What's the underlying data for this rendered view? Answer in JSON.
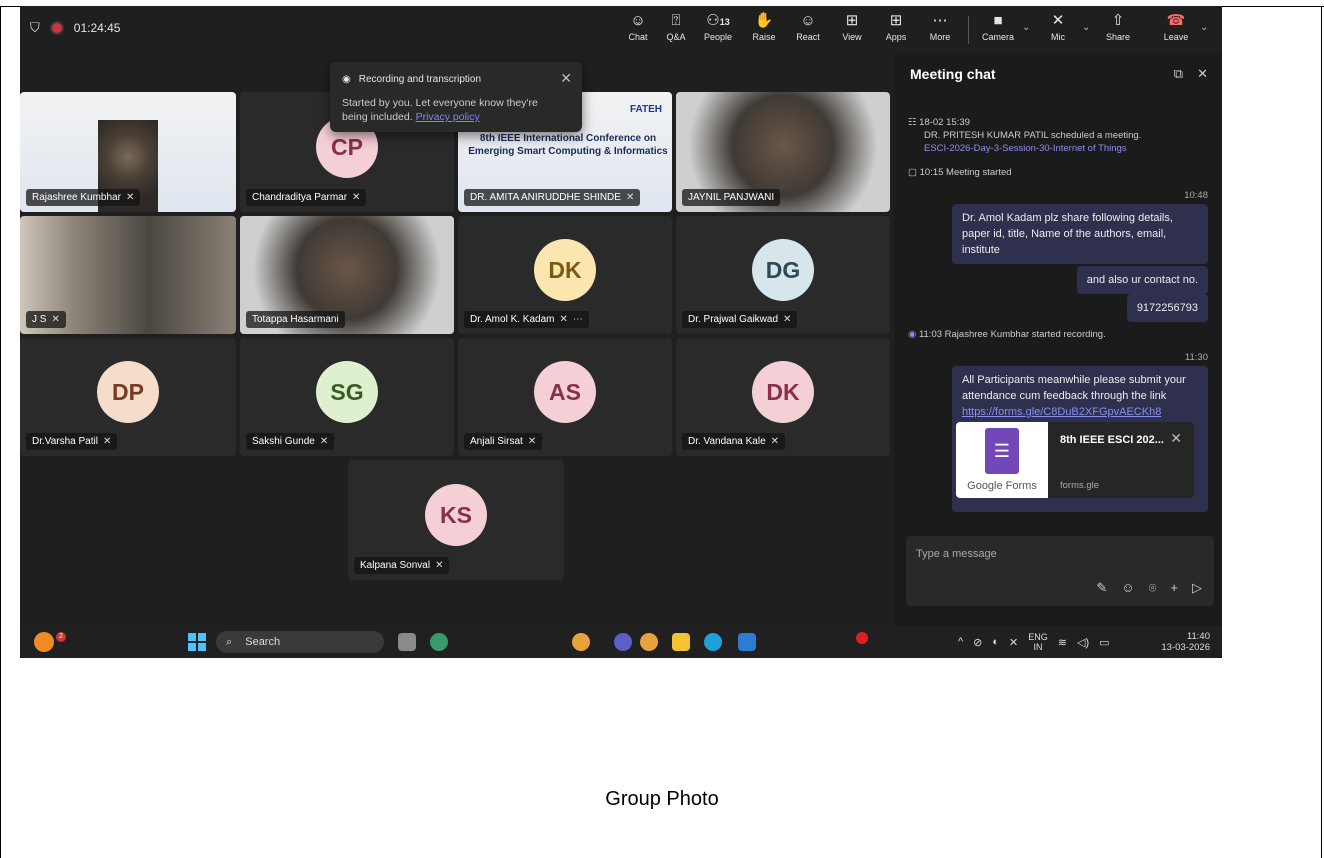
{
  "topbar": {
    "timer": "01:24:45",
    "buttons": [
      {
        "label": "Chat",
        "icon": "chat-icon"
      },
      {
        "label": "Q&A",
        "icon": "qa-icon"
      },
      {
        "label": "People",
        "icon": "people-icon",
        "count": "13"
      },
      {
        "label": "Raise",
        "icon": "raise-hand-icon"
      },
      {
        "label": "React",
        "icon": "react-icon"
      },
      {
        "label": "View",
        "icon": "view-icon"
      },
      {
        "label": "Apps",
        "icon": "apps-icon"
      },
      {
        "label": "More",
        "icon": "more-icon"
      },
      {
        "label": "Camera",
        "icon": "camera-icon"
      },
      {
        "label": "Mic",
        "icon": "mic-muted-icon"
      },
      {
        "label": "Share",
        "icon": "share-icon"
      },
      {
        "label": "Leave",
        "icon": "leave-icon"
      }
    ],
    "people_count": "13"
  },
  "popup": {
    "title": "Recording and transcription",
    "body": "Started by you. Let everyone know they're being included.",
    "link": "Privacy policy"
  },
  "tiles": [
    {
      "name": "Rajashree Kumbhar",
      "kind": "video"
    },
    {
      "name": "Chandraditya Parmar",
      "initials": "CP",
      "color": "#f4cfd6",
      "text": "#8a2f4a"
    },
    {
      "name": "DR. AMITA ANIRUDDHE SHINDE",
      "kind": "video"
    },
    {
      "name": "JAYNIL PANJWANI",
      "kind": "video"
    },
    {
      "name": "J S",
      "kind": "video"
    },
    {
      "name": "Totappa Hasarmani",
      "kind": "video"
    },
    {
      "name": "Dr. Amol K. Kadam",
      "initials": "DK",
      "color": "#fbe6b0",
      "text": "#7a5a10"
    },
    {
      "name": "Dr. Prajwal Gaikwad",
      "initials": "DG",
      "color": "#d7e6ec",
      "text": "#2d4a56"
    },
    {
      "name": "Dr.Varsha Patil",
      "initials": "DP",
      "color": "#f6dccb",
      "text": "#7a3a22"
    },
    {
      "name": "Sakshi Gunde",
      "initials": "SG",
      "color": "#dff0d0",
      "text": "#3b5a22"
    },
    {
      "name": "Anjali Sirsat",
      "initials": "AS",
      "color": "#f4cfd6",
      "text": "#8a2f4a"
    },
    {
      "name": "Dr. Vandana Kale",
      "initials": "DK",
      "color": "#f4cfd6",
      "text": "#8a2f4a"
    },
    {
      "name": "Kalpana Sonval",
      "initials": "KS",
      "color": "#f4cfd6",
      "text": "#8a2f4a"
    }
  ],
  "slide": {
    "conference": "8th IEEE International Conference on Emerging Smart Computing & Informatics",
    "brand": "FATEH"
  },
  "chat": {
    "title": "Meeting chat",
    "events": [
      {
        "time": "18-02 15:39",
        "text": "DR. PRITESH KUMAR PATIL scheduled a meeting.",
        "link": "ESCI-2026-Day-3-Session-30-Internet of Things"
      },
      {
        "time": "10:15",
        "text": "Meeting started"
      },
      {
        "time": "11:03",
        "text": "Rajashree Kumbhar started recording."
      }
    ],
    "messages": [
      {
        "time": "10:48",
        "text": "Dr. Amol Kadam plz share following details, paper id, title, Name of the authors, email, institute"
      },
      {
        "text": "and also ur contact no."
      },
      {
        "text": "9172256793"
      },
      {
        "time": "11:30",
        "text": "All Participants meanwhile please submit your attendance cum feedback through the link",
        "link": "https://forms.gle/C8DuB2XFGpvAECKh8"
      }
    ],
    "card": {
      "title": "8th IEEE ESCI 202...",
      "domain": "forms.gle",
      "brand": "Google Forms"
    },
    "input_placeholder": "Type a message"
  },
  "taskbar": {
    "search": "Search",
    "lang1": "ENG",
    "lang2": "IN",
    "time": "11:40",
    "date": "13-03-2026",
    "badge": "2"
  },
  "caption": "Group Photo"
}
